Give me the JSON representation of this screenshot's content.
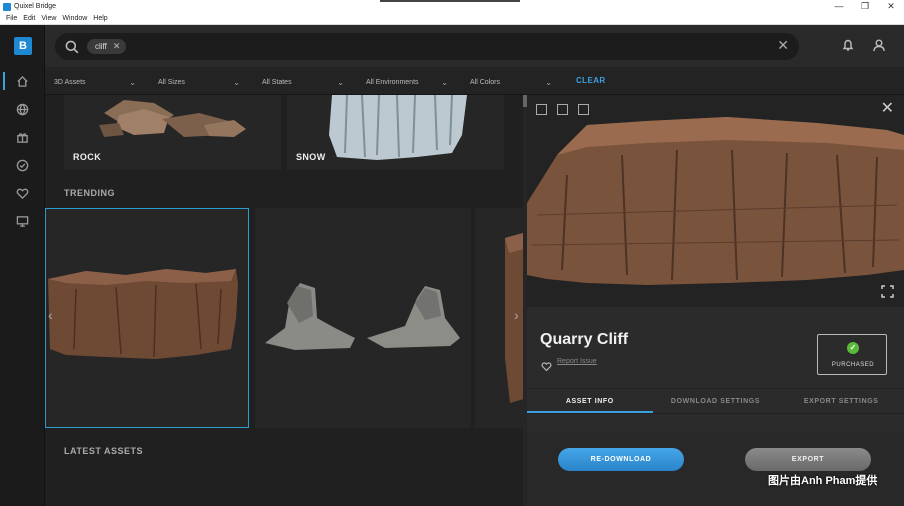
{
  "window": {
    "title": "Quixel Bridge",
    "controls": [
      "—",
      "❐",
      "✕"
    ]
  },
  "menu": [
    "File",
    "Edit",
    "View",
    "Window",
    "Help"
  ],
  "rail": {
    "brand_letter": "B",
    "items": [
      "home-icon",
      "globe-icon",
      "gift-icon",
      "check-circle-icon",
      "heart-icon",
      "monitor-icon"
    ]
  },
  "search": {
    "chip_label": "cliff",
    "chip_remove": "✕",
    "clear": "✕"
  },
  "filters": {
    "items": [
      "3D Assets",
      "All Sizes",
      "All States",
      "All Environments",
      "All Colors"
    ],
    "clear_label": "CLEAR"
  },
  "browse": {
    "categories": [
      "ROCK",
      "SNOW"
    ],
    "trending_title": "TRENDING",
    "latest_title": "LATEST ASSETS"
  },
  "details": {
    "asset_name": "Quarry Cliff",
    "report_label": "Report Issue",
    "purchased_label": "PURCHASED",
    "tabs": [
      {
        "label": "ASSET INFO",
        "active": true
      },
      {
        "label": "DOWNLOAD SETTINGS",
        "active": false
      },
      {
        "label": "EXPORT SETTINGS",
        "active": false
      }
    ],
    "redownload_label": "RE-DOWNLOAD",
    "export_label": "EXPORT",
    "watermark": "图片由Anh Pham提供"
  },
  "colors": {
    "accent": "#3aa0e0",
    "purchased": "#59b93b",
    "brand": "#1e88d2"
  }
}
